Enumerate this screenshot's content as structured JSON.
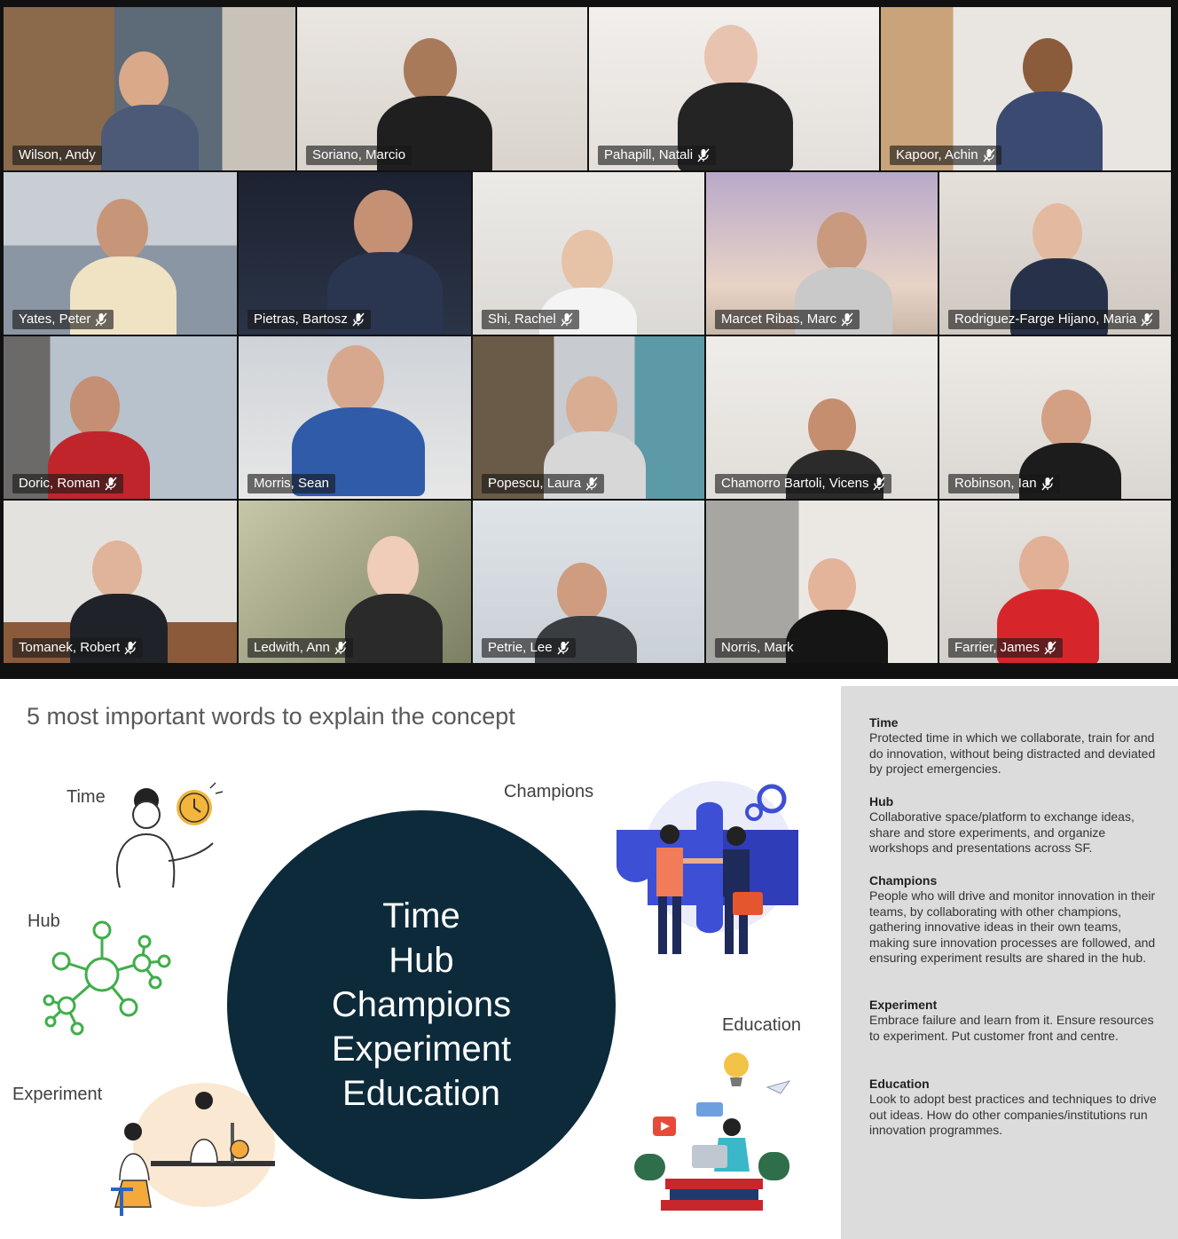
{
  "participants": [
    {
      "name": "Wilson, Andy",
      "muted": false
    },
    {
      "name": "Soriano, Marcio",
      "muted": false
    },
    {
      "name": "Pahapill, Natali",
      "muted": true
    },
    {
      "name": "Kapoor, Achin",
      "muted": true
    },
    {
      "name": "Yates, Peter",
      "muted": true
    },
    {
      "name": "Pietras, Bartosz",
      "muted": true
    },
    {
      "name": "Shi, Rachel",
      "muted": true
    },
    {
      "name": "Marcet Ribas, Marc",
      "muted": true
    },
    {
      "name": "Rodriguez-Farge Hijano, Maria",
      "muted": true
    },
    {
      "name": "Doric, Roman",
      "muted": true
    },
    {
      "name": "Morris, Sean",
      "muted": false
    },
    {
      "name": "Popescu, Laura",
      "muted": true
    },
    {
      "name": "Chamorro Bartoli, Vicens",
      "muted": true
    },
    {
      "name": "Robinson, Ian",
      "muted": true
    },
    {
      "name": "Tomanek, Robert",
      "muted": true
    },
    {
      "name": "Ledwith, Ann",
      "muted": true
    },
    {
      "name": "Petrie, Lee",
      "muted": true
    },
    {
      "name": "Norris, Mark",
      "muted": false
    },
    {
      "name": "Farrier, James",
      "muted": true
    }
  ],
  "slide": {
    "title": "5 most important words to explain the concept",
    "labels": {
      "time": "Time",
      "hub": "Hub",
      "experiment": "Experiment",
      "champions": "Champions",
      "education": "Education"
    },
    "center_words": [
      "Time",
      "Hub",
      "Champions",
      "Experiment",
      "Education"
    ],
    "circle_color": "#0c2a3a"
  },
  "descriptions": [
    {
      "heading": "Time",
      "text": "Protected time in which we collaborate, train for and do innovation, without being distracted and deviated by project emergencies."
    },
    {
      "heading": "Hub",
      "text": "Collaborative space/platform to exchange ideas, share and store experiments, and organize workshops and presentations across SF."
    },
    {
      "heading": "Champions",
      "text": "People who will drive and monitor innovation in their teams, by collaborating with other champions, gathering innovative ideas in their own teams, making sure innovation processes are followed, and ensuring experiment results are shared in the hub."
    },
    {
      "heading": "Experiment",
      "text": "Embrace failure and learn from it. Ensure resources to experiment. Put customer front and centre."
    },
    {
      "heading": "Education",
      "text": "Look to adopt best practices and techniques to drive out ideas. How do other companies/institutions run innovation programmes."
    }
  ]
}
